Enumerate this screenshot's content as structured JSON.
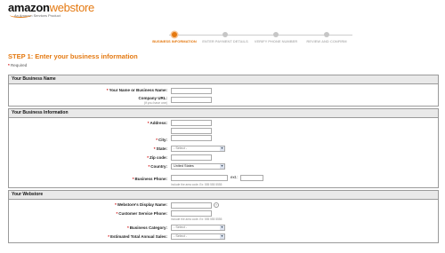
{
  "header": {
    "logo_amazon": "amazon",
    "logo_webstore": "webstore",
    "logo_sub": "An Amazon Services Product"
  },
  "steps": [
    {
      "label": "BUSINESS INFORMATION",
      "active": true
    },
    {
      "label": "ENTER PAYMENT DETAILS",
      "active": false
    },
    {
      "label": "VERIFY PHONE NUMBER",
      "active": false
    },
    {
      "label": "REVIEW AND CONFIRM",
      "active": false
    }
  ],
  "page": {
    "title": "STEP 1: Enter your business information",
    "required_note": "Required"
  },
  "sections": {
    "business_name": {
      "title": "Your Business Name",
      "name_label": "Your Name or Business Name:",
      "company_url_label": "Company URL:",
      "company_url_hint": "(if you have one)"
    },
    "business_info": {
      "title": "Your Business Information",
      "address_label": "Address:",
      "city_label": "City:",
      "state_label": "State:",
      "state_value": "- Select -",
      "zip_label": "Zip code:",
      "country_label": "Country:",
      "country_value": "United States",
      "phone_label": "Business Phone:",
      "ext_label": "ext.:",
      "phone_hint": "Include the area code. Ex: 555 555 5555"
    },
    "webstore": {
      "title": "Your Webstore",
      "display_name_label": "Webstore's Display Name:",
      "cs_phone_label": "Customer Service Phone:",
      "cs_phone_hint": "Include the area code. Ex: 555 555 5555",
      "category_label": "Business Category:",
      "category_value": "- Select -",
      "sales_label": "Estimated Total Annual Sales:",
      "sales_value": "- Select -"
    }
  },
  "colors": {
    "accent": "#e47911",
    "required": "#cc0000",
    "section_header_bg": "#e9e9e9"
  }
}
